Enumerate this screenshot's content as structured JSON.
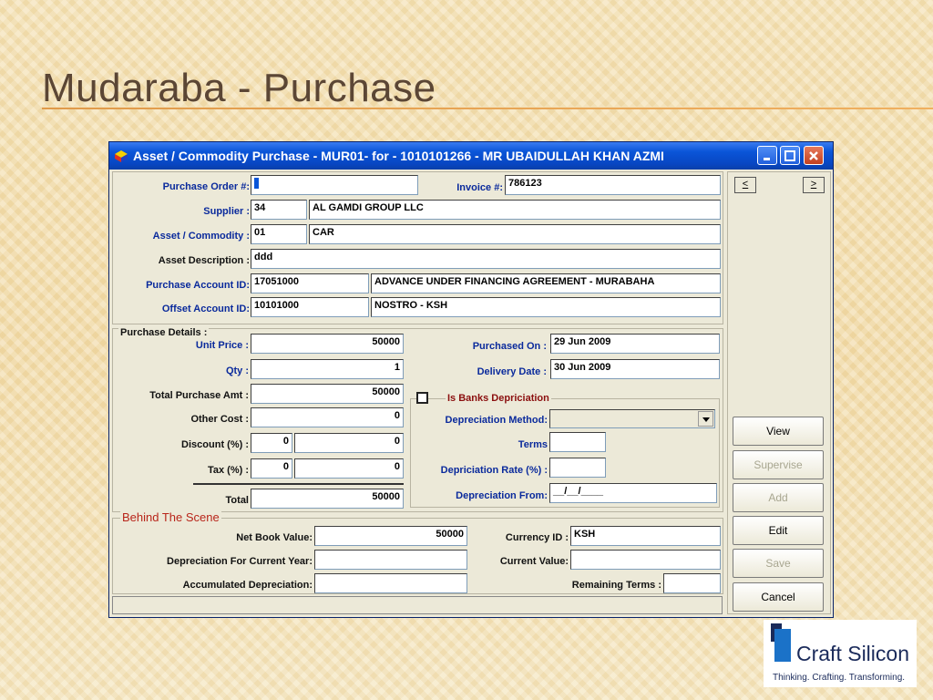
{
  "slide": {
    "title": "Mudaraba - Purchase"
  },
  "window": {
    "title": "Asset / Commodity Purchase - MUR01- for  - 1010101266 - MR UBAIDULLAH KHAN AZMI"
  },
  "header_fields": {
    "purchase_order_label": "Purchase Order #:",
    "purchase_order_value": "",
    "invoice_label": "Invoice #:",
    "invoice_value": "786123",
    "supplier_label": "Supplier :",
    "supplier_code": "34",
    "supplier_name": "AL GAMDI GROUP LLC",
    "asset_label": "Asset / Commodity :",
    "asset_code": "01",
    "asset_name": "CAR",
    "asset_desc_label": "Asset  Description :",
    "asset_desc_value": "ddd",
    "purchase_account_label": "Purchase Account ID:",
    "purchase_account_id": "17051000",
    "purchase_account_name": "ADVANCE UNDER FINANCING AGREEMENT - MURABAHA",
    "offset_account_label": "Offset Account ID:",
    "offset_account_id": "10101000",
    "offset_account_name": "NOSTRO - KSH"
  },
  "purchase_details": {
    "group_title": "Purchase Details :",
    "unit_price_label": "Unit Price :",
    "unit_price": "50000",
    "qty_label": "Qty :",
    "qty": "1",
    "total_purchase_label": "Total Purchase Amt :",
    "total_purchase": "50000",
    "other_cost_label": "Other Cost :",
    "other_cost": "0",
    "discount_label": "Discount (%) :",
    "discount_pct": "0",
    "discount_amt": "0",
    "tax_label": "Tax (%) :",
    "tax_pct": "0",
    "tax_amt": "0",
    "total_label": "Total",
    "total": "50000",
    "purchased_on_label": "Purchased On :",
    "purchased_on": "29 Jun 2009",
    "delivery_date_label": "Delivery Date :",
    "delivery_date": "30 Jun 2009",
    "depreciation_check_label": "Is Banks Depriciation",
    "depreciation_method_label": "Depreciation Method:",
    "depreciation_method": "",
    "terms_label": "Terms",
    "terms": "",
    "dep_rate_label": "Depriciation Rate (%) :",
    "dep_rate": "",
    "dep_from_label": "Depreciation From:",
    "dep_from": "__/__/____"
  },
  "behind_scene": {
    "group_title": "Behind The Scene",
    "net_book_label": "Net Book Value:",
    "net_book_value": "50000",
    "dep_current_label": "Depreciation For Current Year:",
    "dep_current_value": "",
    "accum_dep_label": "Accumulated Depreciation:",
    "accum_dep_value": "",
    "currency_label": "Currency ID :",
    "currency_value": "KSH",
    "current_value_label": "Current Value:",
    "current_value": "",
    "remaining_terms_label": "Remaining Terms :",
    "remaining_terms": ""
  },
  "buttons": {
    "prev": "<",
    "next": ">",
    "view": "View",
    "supervise": "Supervise",
    "add": "Add",
    "edit": "Edit",
    "save": "Save",
    "cancel": "Cancel"
  },
  "logo": {
    "name": "Craft Silicon",
    "tagline": "Thinking. Crafting. Transforming."
  },
  "colors": {
    "titlebar": "#0a55d8",
    "label_blue": "#0a2a9c",
    "label_red": "#8b0f0f",
    "window_bg": "#ece9d8"
  }
}
